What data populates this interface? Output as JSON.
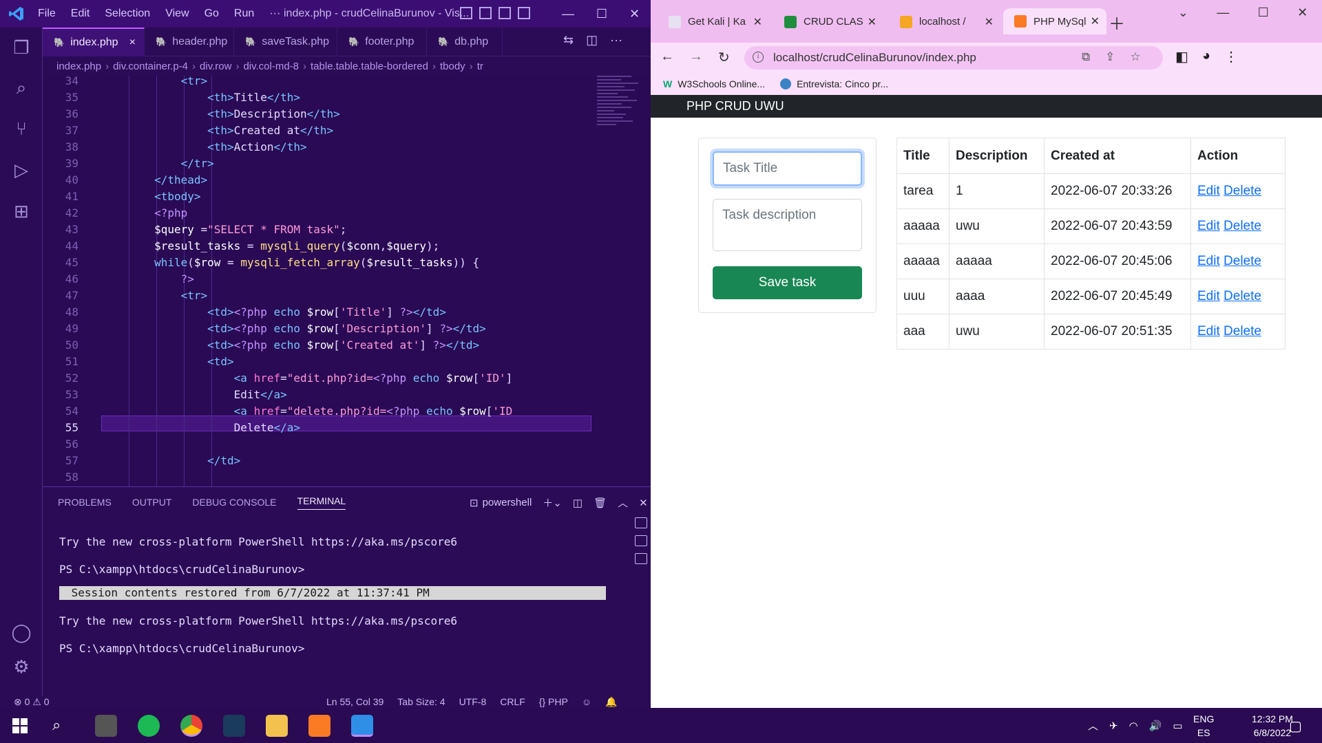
{
  "vscode": {
    "menu": [
      "File",
      "Edit",
      "Selection",
      "View",
      "Go",
      "Run",
      "···"
    ],
    "title": "index.php - crudCelinaBurunov - Vis...",
    "tabs": [
      "index.php",
      "header.php",
      "saveTask.php",
      "footer.php",
      "db.php"
    ],
    "active_tab_close": "×",
    "breadcrumb": [
      "index.php",
      "div.container.p-4",
      "div.row",
      "div.col-md-8",
      "table.table.table-bordered",
      "tbody",
      "tr"
    ],
    "line_numbers": [
      "34",
      "35",
      "36",
      "37",
      "38",
      "39",
      "40",
      "41",
      "42",
      "43",
      "44",
      "45",
      "46",
      "47",
      "48",
      "49",
      "50",
      "51",
      "52",
      "53",
      "54",
      "55",
      "56",
      "57",
      "58"
    ],
    "panel_tabs": [
      "PROBLEMS",
      "OUTPUT",
      "DEBUG CONSOLE",
      "TERMINAL"
    ],
    "terminal_shell": "powershell",
    "terminal_lines": [
      "Try the new cross-platform PowerShell https://aka.ms/pscore6",
      "PS C:\\xampp\\htdocs\\crudCelinaBurunov>",
      " Session contents restored from 6/7/2022 at 11:37:41 PM",
      "Try the new cross-platform PowerShell https://aka.ms/pscore6",
      "PS C:\\xampp\\htdocs\\crudCelinaBurunov>"
    ],
    "status": {
      "problems": "⊗ 0 ⚠ 0",
      "position": "Ln 55, Col 39",
      "tab_size": "Tab Size: 4",
      "encoding": "UTF-8",
      "eol": "CRLF",
      "language": "{} PHP"
    }
  },
  "chrome": {
    "tabs": [
      "Get Kali | Ka",
      "CRUD CLAS",
      "localhost /",
      "PHP MySql"
    ],
    "url": "localhost/crudCelinaBurunov/index.php",
    "bookmarks": [
      "W3Schools Online...",
      "Entrevista: Cinco pr..."
    ]
  },
  "app": {
    "brand": "PHP CRUD UWU",
    "title_placeholder": "Task Title",
    "description_placeholder": "Task description",
    "save_label": "Save task",
    "table_headers": [
      "Title",
      "Description",
      "Created at",
      "Action"
    ],
    "rows": [
      {
        "title": "tarea",
        "description": "1",
        "created": "2022-06-07 20:33:26"
      },
      {
        "title": "aaaaa",
        "description": "uwu",
        "created": "2022-06-07 20:43:59"
      },
      {
        "title": "aaaaa",
        "description": "aaaaa",
        "created": "2022-06-07 20:45:06"
      },
      {
        "title": "uuu",
        "description": "aaaa",
        "created": "2022-06-07 20:45:49"
      },
      {
        "title": "aaa",
        "description": "uwu",
        "created": "2022-06-07 20:51:35"
      }
    ],
    "edit_label": "Edit",
    "delete_label": "Delete"
  },
  "taskbar": {
    "lang_1": "ENG",
    "lang_2": "ES",
    "time": "12:32 PM",
    "date": "6/8/2022"
  },
  "colors": {
    "accent_purple": "#c25bff",
    "bootstrap_green": "#198754",
    "link_blue": "#0d6efd",
    "chrome_tab_bar": "#f0bdf0"
  }
}
